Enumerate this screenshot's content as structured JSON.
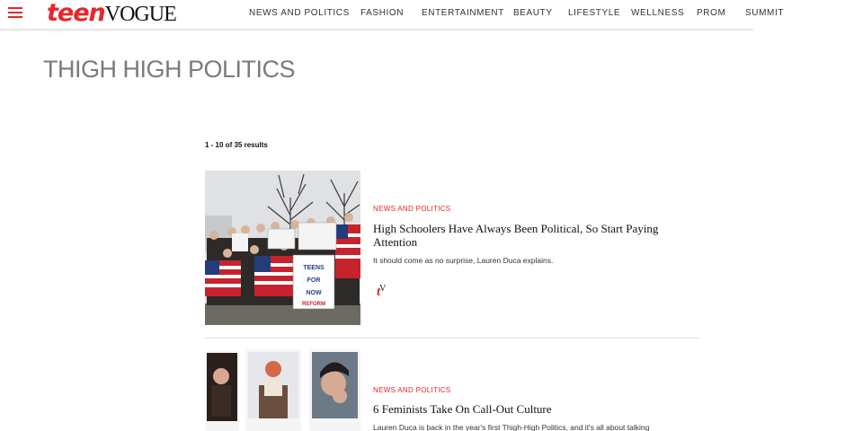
{
  "header": {
    "logo": {
      "part1": "teen",
      "part2": "VOGUE"
    },
    "nav": [
      "NEWS AND POLITICS",
      "FASHION",
      "ENTERTAINMENT",
      "BEAUTY",
      "LIFESTYLE",
      "WELLNESS",
      "PROM",
      "SUMMIT"
    ]
  },
  "page_title": "THIGH HIGH POLITICS",
  "results_count": "1 - 10 of 35 results",
  "articles": [
    {
      "category": "NEWS AND POLITICS",
      "headline": "High Schoolers Have Always Been Political, So Start Paying Attention",
      "dek": "It should come as no surprise, Lauren Duca explains.",
      "sign_text": "TEENS FOR REFORM NOW"
    },
    {
      "category": "NEWS AND POLITICS",
      "headline": "6 Feminists Take On Call-Out Culture",
      "dek": "Lauren Duca is back in the year's first Thigh-High Politics, and it's all about talking"
    }
  ],
  "colors": {
    "accent": "#e8262b",
    "title_gray": "#7b7b7b"
  },
  "icons": {
    "menu": "hamburger-menu-icon",
    "brand_mark": "tv-logo-icon"
  }
}
